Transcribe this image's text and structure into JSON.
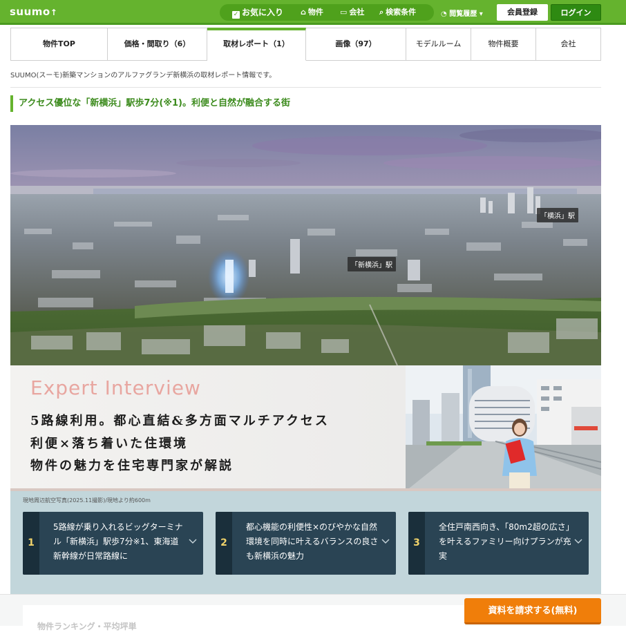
{
  "header": {
    "logo": "suumo",
    "favorites_label": "お気に入り",
    "property_label": "物件",
    "company_label": "会社",
    "search_conditions_label": "検索条件",
    "history_label": "閲覧履歴",
    "register_label": "会員登録",
    "login_label": "ログイン",
    "brand_color": "#65b32e"
  },
  "tabs": [
    {
      "label": "物件TOP"
    },
    {
      "label": "価格・間取り（6）"
    },
    {
      "label": "取材レポート（1）"
    },
    {
      "label": "画像（97）"
    },
    {
      "label": "モデルルーム"
    },
    {
      "label": "物件概要"
    },
    {
      "label": "会社"
    }
  ],
  "intro": "SUUMO(スーモ)新築マンションのアルファグランデ新横浜の取材レポート情報です。",
  "heading": "アクセス優位な「新横浜」駅歩7分(※1)。利便と自然が融合する街",
  "hero": {
    "label_yokohama": "「横浜」駅",
    "label_shinyokohama": "「新横浜」駅"
  },
  "banner": {
    "title": "Expert Interview",
    "line1": "5路線利用。都心直結&多方面マルチアクセス",
    "line2": "利便×落ち着いた住環境",
    "line3": "物件の魅力を住宅専門家が解説"
  },
  "points": {
    "caption": "現地周辺航空写真(2025.11撮影)/現地より約600m",
    "cards": [
      {
        "num": "1",
        "text": "5路線が乗り入れるビッグターミナル「新横浜」駅歩7分※1、東海道新幹線が日常路線に"
      },
      {
        "num": "2",
        "text": "都心機能の利便性×のびやかな自然環境を同時に叶えるバランスの良さも新横浜の魅力"
      },
      {
        "num": "3",
        "text": "全住戸南西向き、「80m2超の広さ」を叶えるファミリー向けプランが充実"
      }
    ]
  },
  "bottom": {
    "faint_text": "物件ランキング・平均坪単",
    "cta_label": "資料を請求する(無料)"
  }
}
